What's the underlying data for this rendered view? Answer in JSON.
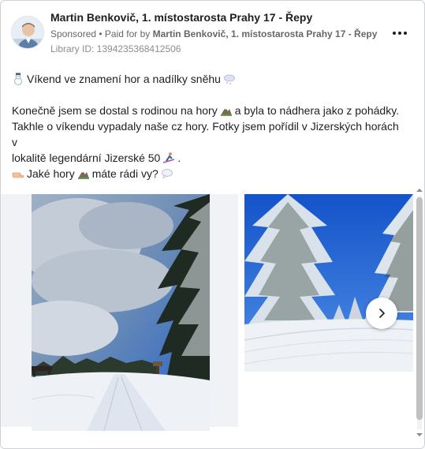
{
  "post": {
    "author": "Martin Benkovič, 1. místostarosta Prahy 17 - Řepy",
    "sponsored": "Sponsored",
    "separator": " • ",
    "paid_for_prefix": "Paid for by ",
    "paid_for_name": "Martin Benkovič, 1. místostarosta Prahy 17 - Řepy",
    "library_id": "Library ID: 1394235368412506"
  },
  "body": {
    "line1": "Víkend ve znamení hor a nadílky sněhu",
    "para2_a": "Konečně jsem se dostal s rodinou na hory",
    "para2_b": "a byla to nádhera jako z pohádky.",
    "para2_line2": "Takhle o víkendu vypadaly naše cz hory. Fotky jsem pořídil v Jizerských horách v",
    "para2_line3": "lokalitě legendární Jizerské 50",
    "para2_line3_end": ".",
    "line4_a": "Jaké hory",
    "line4_b": "máte rádi vy?"
  },
  "icons": {
    "menu": "more-horizontal-icon",
    "next": "chevron-right-icon",
    "emoji_1": "snowman-emoji",
    "emoji_2": "cloud-snow-emoji",
    "emoji_3": "mountain-emoji",
    "emoji_4": "skier-emoji",
    "emoji_5": "pointing-hand-emoji",
    "emoji_6": "speech-bubble-emoji"
  },
  "colors": {
    "text": "#1c1e21",
    "secondary": "#65676b",
    "sky": "#2f6fd6",
    "snow": "#eef2f7"
  }
}
